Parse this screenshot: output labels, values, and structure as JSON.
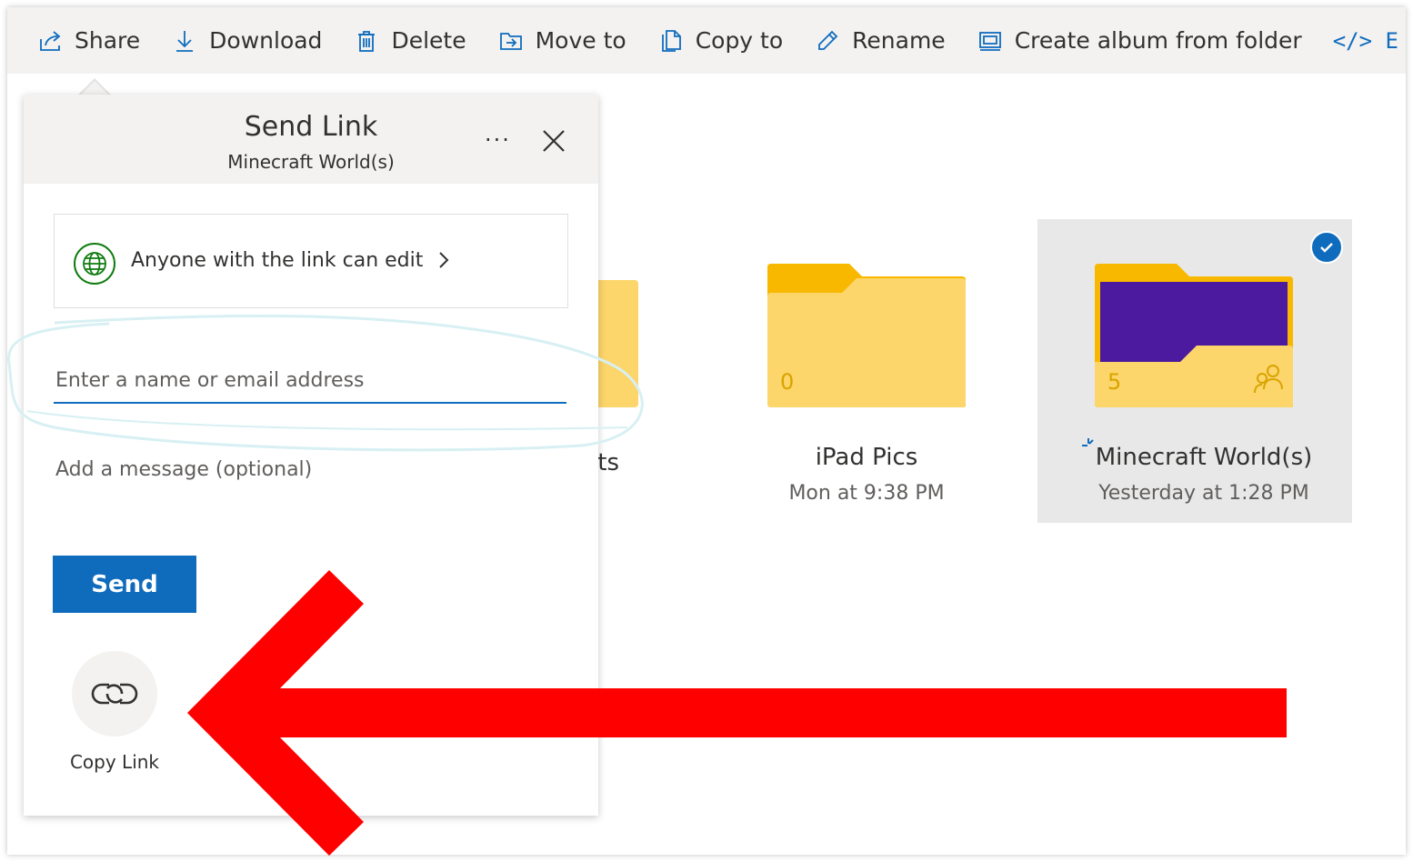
{
  "toolbar": {
    "items": [
      {
        "label": "Share",
        "icon": "share-icon"
      },
      {
        "label": "Download",
        "icon": "download-icon"
      },
      {
        "label": "Delete",
        "icon": "delete-icon"
      },
      {
        "label": "Move to",
        "icon": "move-to-icon"
      },
      {
        "label": "Copy to",
        "icon": "copy-to-icon"
      },
      {
        "label": "Rename",
        "icon": "rename-icon"
      },
      {
        "label": "Create album from folder",
        "icon": "album-icon"
      }
    ],
    "embed_glyph": "</> E"
  },
  "panel": {
    "title": "Send Link",
    "subtitle": "Minecraft World(s)",
    "more": "···",
    "permission": "Anyone with the link can edit",
    "email_placeholder": "Enter a name or email address",
    "message_placeholder": "Add a message (optional)",
    "send_label": "Send",
    "copy_link_label": "Copy Link"
  },
  "files": [
    {
      "name": "...nts",
      "date": "",
      "count": ""
    },
    {
      "name": "iPad Pics",
      "date": "Mon at 9:38 PM",
      "count": "0"
    },
    {
      "name": "Minecraft World(s)",
      "date": "Yesterday at 1:28 PM",
      "count": "5",
      "selected": true,
      "shared": true
    }
  ],
  "colors": {
    "accent": "#0f6cbd",
    "folder": "#fcd56b",
    "folder_tab": "#f8b800",
    "arrow": "#ff0000",
    "thumb": "#4b1a9e"
  }
}
